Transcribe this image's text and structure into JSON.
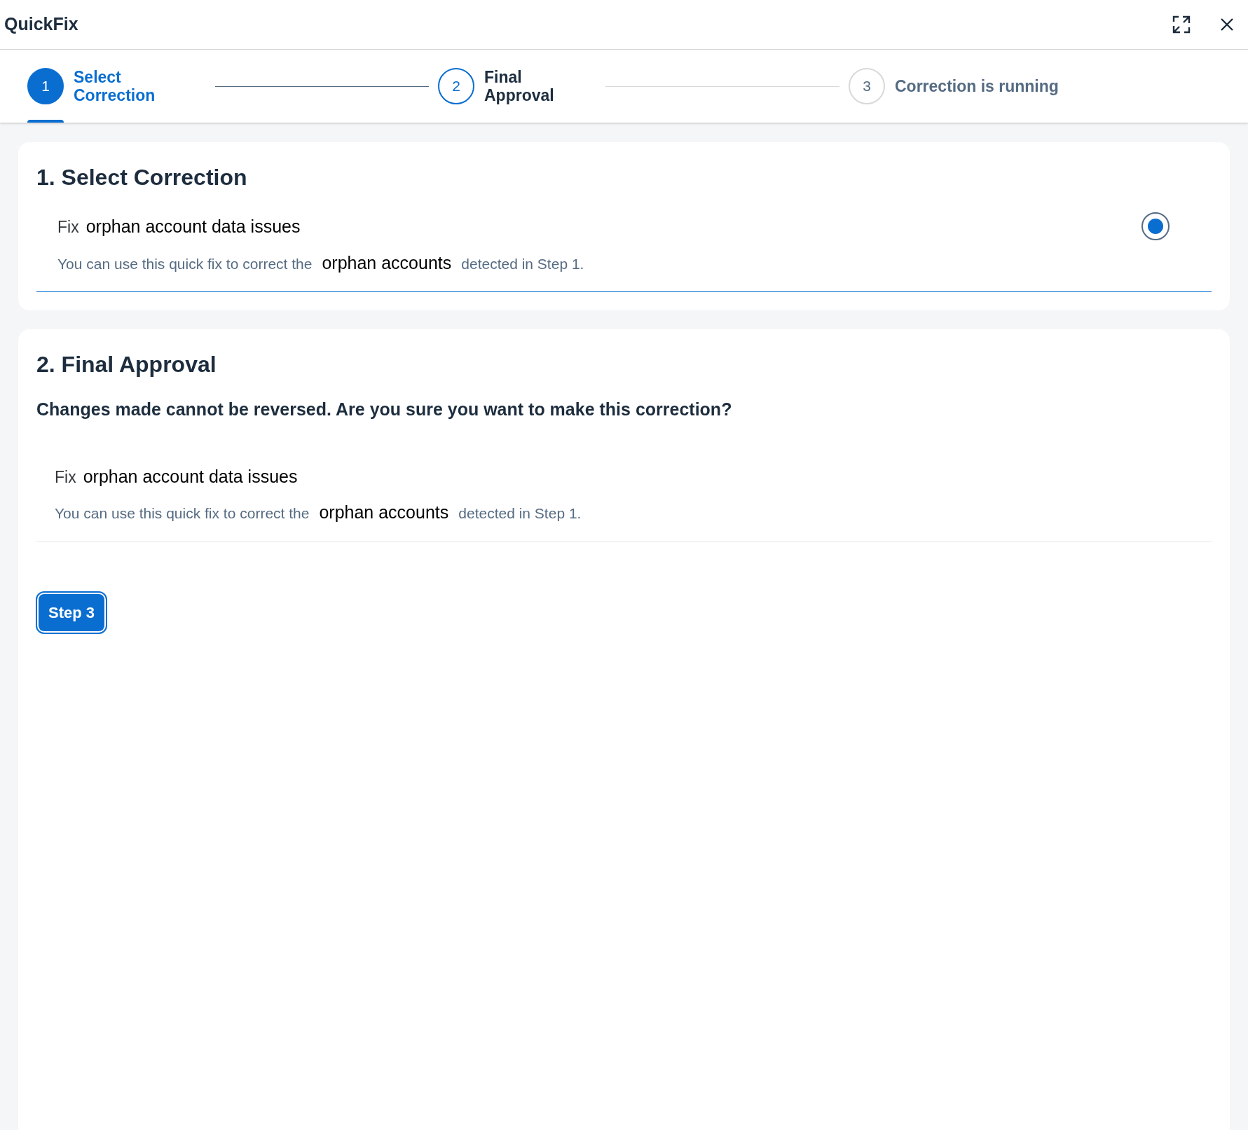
{
  "window": {
    "title": "QuickFix"
  },
  "steps": [
    {
      "number": "1",
      "label": "Select Correction",
      "selected": true,
      "reached": true
    },
    {
      "number": "2",
      "label": "Final Approval",
      "selected": false,
      "reached": true
    },
    {
      "number": "3",
      "label": "Correction is running",
      "selected": false,
      "reached": false
    }
  ],
  "select_section": {
    "heading": "1. Select Correction",
    "option": {
      "prefix": "Fix",
      "title": "orphan account data issues",
      "description_before": "You can use this quick fix to correct the",
      "description_highlight": "orphan accounts",
      "description_after": "detected in Step 1.",
      "selected": true
    }
  },
  "approval_section": {
    "heading": "2. Final Approval",
    "question": "Changes made cannot be reversed. Are you sure you want to make this correction?",
    "option": {
      "prefix": "Fix",
      "title": "orphan account data issues",
      "description_before": "You can use this quick fix to correct the",
      "description_highlight": "orphan accounts",
      "description_after": "detected in Step 1."
    },
    "button": "Step 3"
  }
}
